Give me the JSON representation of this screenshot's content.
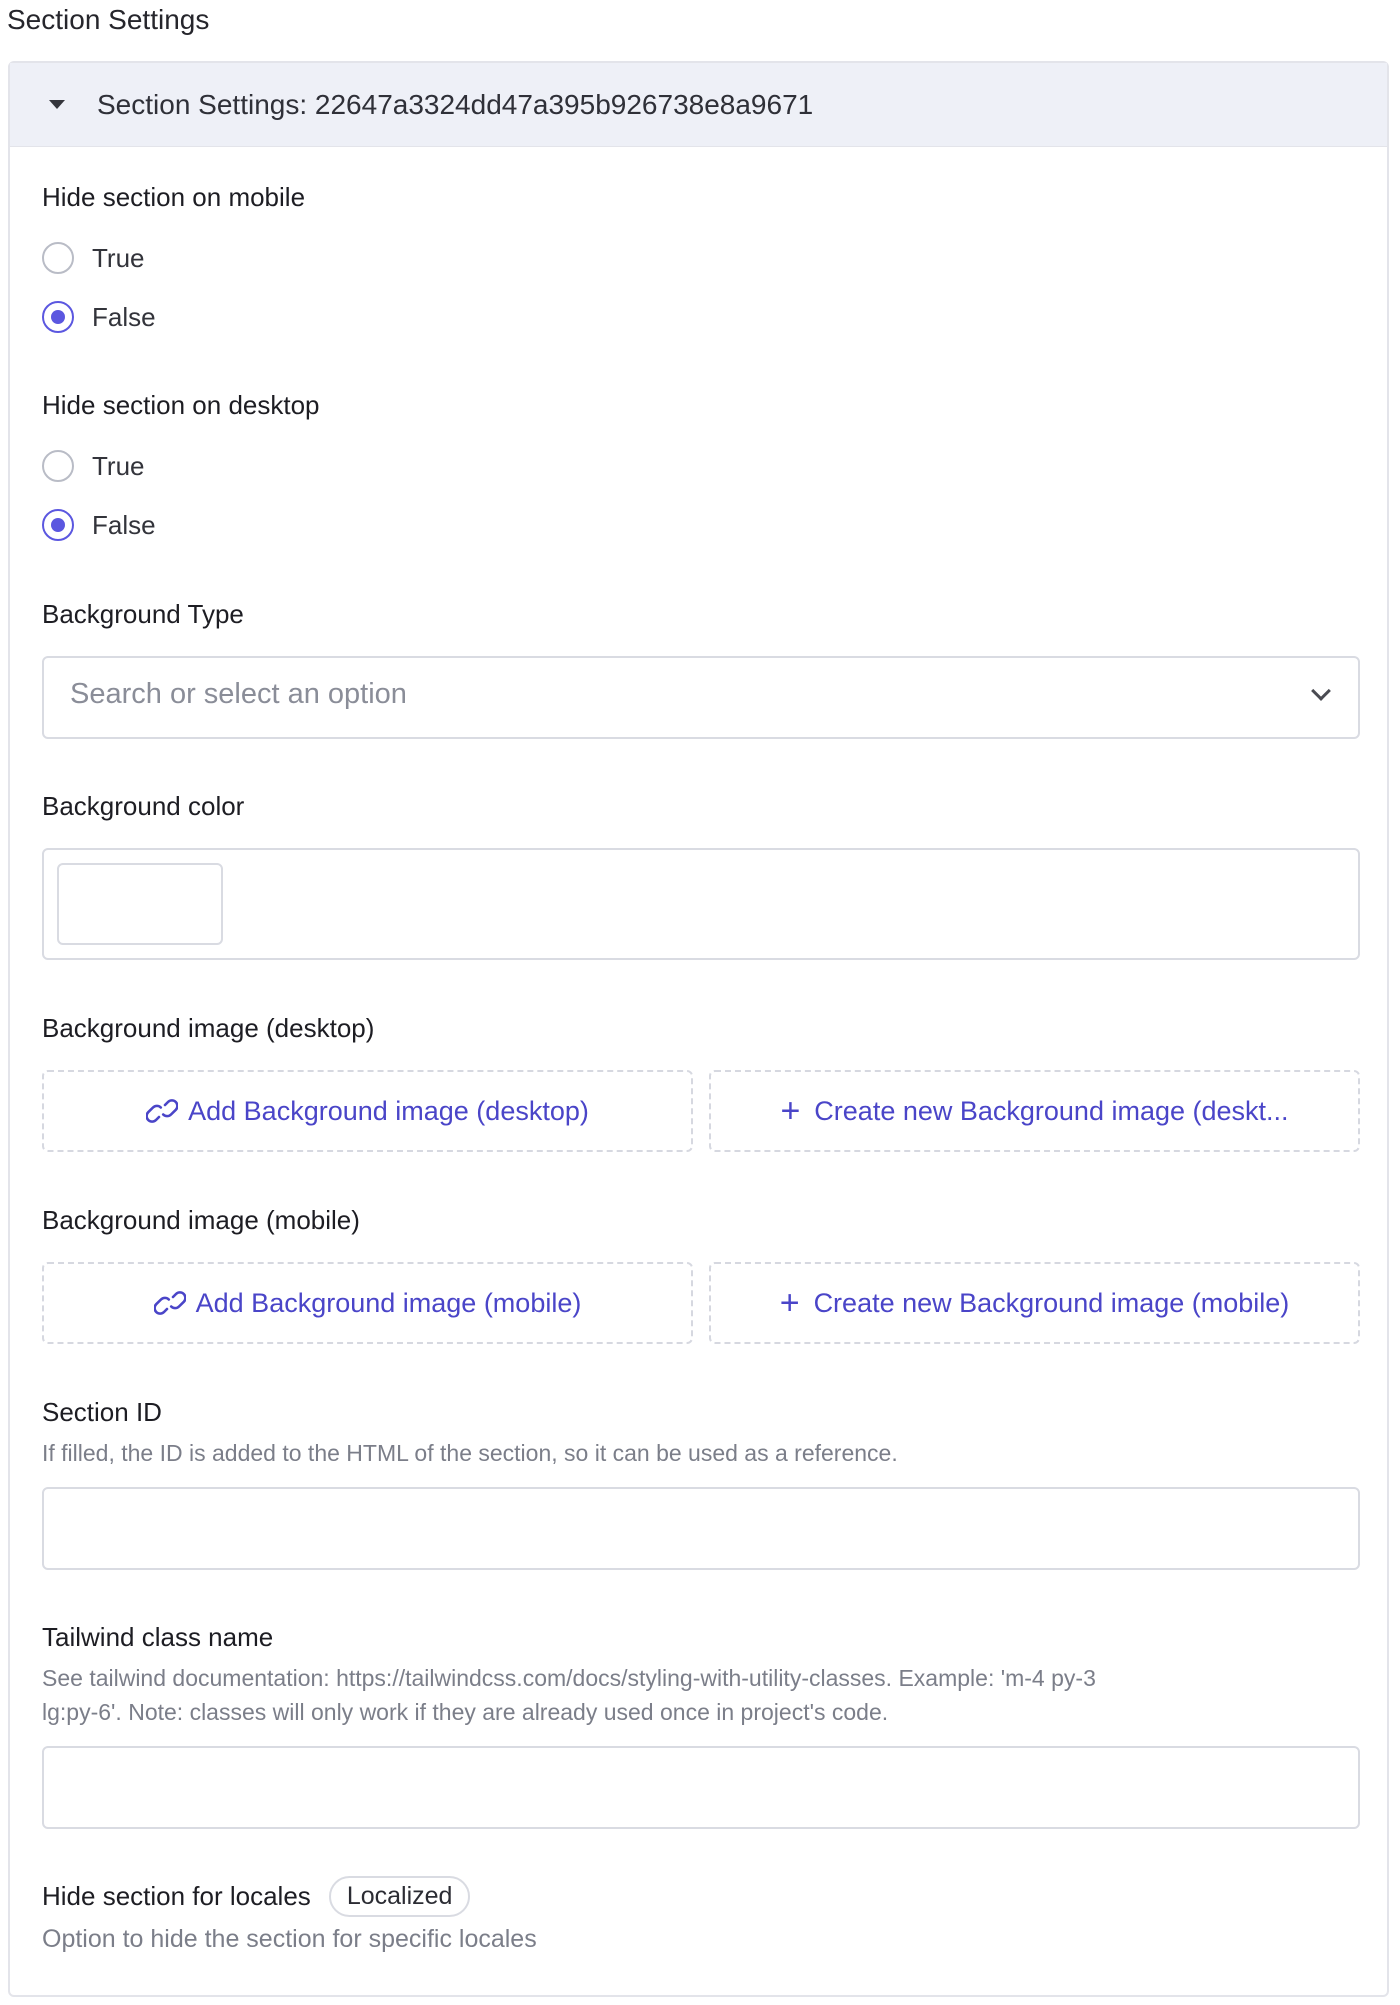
{
  "page": {
    "title": "Section Settings"
  },
  "panel": {
    "header": "Section Settings: 22647a3324dd47a395b926738e8a9671"
  },
  "hide_mobile": {
    "label": "Hide section on mobile",
    "options": [
      {
        "label": "True",
        "checked": false
      },
      {
        "label": "False",
        "checked": true
      }
    ]
  },
  "hide_desktop": {
    "label": "Hide section on desktop",
    "options": [
      {
        "label": "True",
        "checked": false
      },
      {
        "label": "False",
        "checked": true
      }
    ]
  },
  "background_type": {
    "label": "Background Type",
    "placeholder": "Search or select an option"
  },
  "background_color": {
    "label": "Background color"
  },
  "bg_desktop": {
    "label": "Background image (desktop)",
    "add_label": "Add Background image (desktop)",
    "create_label": "Create new Background image (deskt..."
  },
  "bg_mobile": {
    "label": "Background image (mobile)",
    "add_label": "Add Background image (mobile)",
    "create_label": "Create new Background image (mobile)"
  },
  "section_id": {
    "label": "Section ID",
    "help": "If filled, the ID is added to the HTML of the section, so it can be used as a reference.",
    "value": ""
  },
  "tailwind": {
    "label": "Tailwind class name",
    "help_line1": "See tailwind documentation: https://tailwindcss.com/docs/styling-with-utility-classes. Example: 'm-4 py-3",
    "help_line2": "lg:py-6'. Note: classes will only work if they are already used once in project's code.",
    "value": ""
  },
  "locales": {
    "label": "Hide section for locales",
    "badge": "Localized",
    "help": "Option to hide the section for specific locales"
  },
  "colors": {
    "accent": "#5b57e0",
    "link": "#4a45c8",
    "header_bg": "#eef0f7"
  }
}
